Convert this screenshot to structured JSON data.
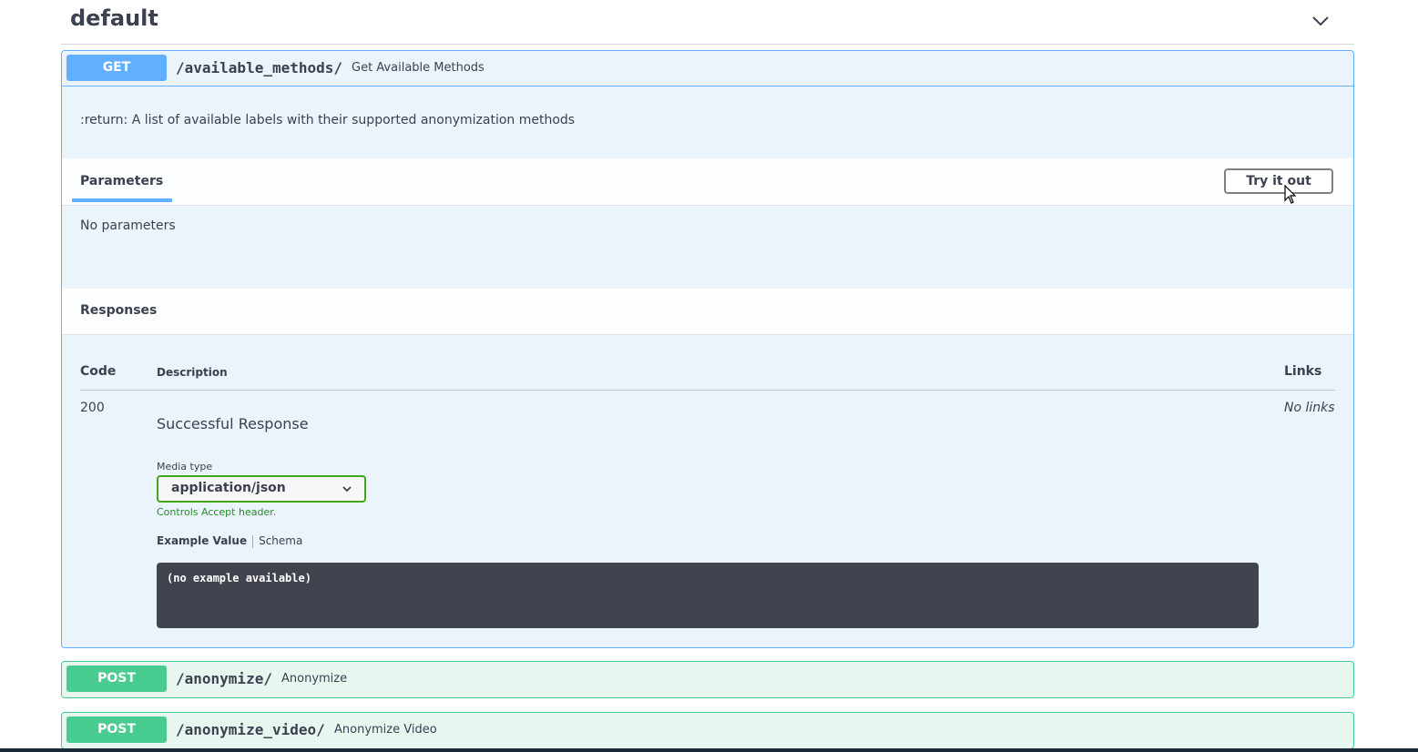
{
  "section": {
    "title": "default",
    "icon": "chevron-down-icon"
  },
  "get_op": {
    "method": "GET",
    "path": "/available_methods/",
    "summary": "Get Available Methods",
    "description": ":return: A list of available labels with their supported anonymization methods",
    "parameters_tab": "Parameters",
    "try_button": "Try it out",
    "no_params": "No parameters",
    "responses_title": "Responses",
    "table": {
      "col_code": "Code",
      "col_description": "Description",
      "col_links": "Links"
    },
    "response": {
      "code": "200",
      "description": "Successful Response",
      "links": "No links",
      "media_type_label": "Media type",
      "media_type_value": "application/json",
      "accept_hint": "Controls Accept header.",
      "example_tab": "Example Value",
      "schema_tab": "Schema",
      "example_body": "(no example available)"
    }
  },
  "post_ops": [
    {
      "method": "POST",
      "path": "/anonymize/",
      "summary": "Anonymize"
    },
    {
      "method": "POST",
      "path": "/anonymize_video/",
      "summary": "Anonymize Video"
    }
  ],
  "colors": {
    "get": "#61affe",
    "post": "#49cc90",
    "text": "#3b4151",
    "select_border": "#41a71c",
    "code_bg": "#41444e"
  }
}
